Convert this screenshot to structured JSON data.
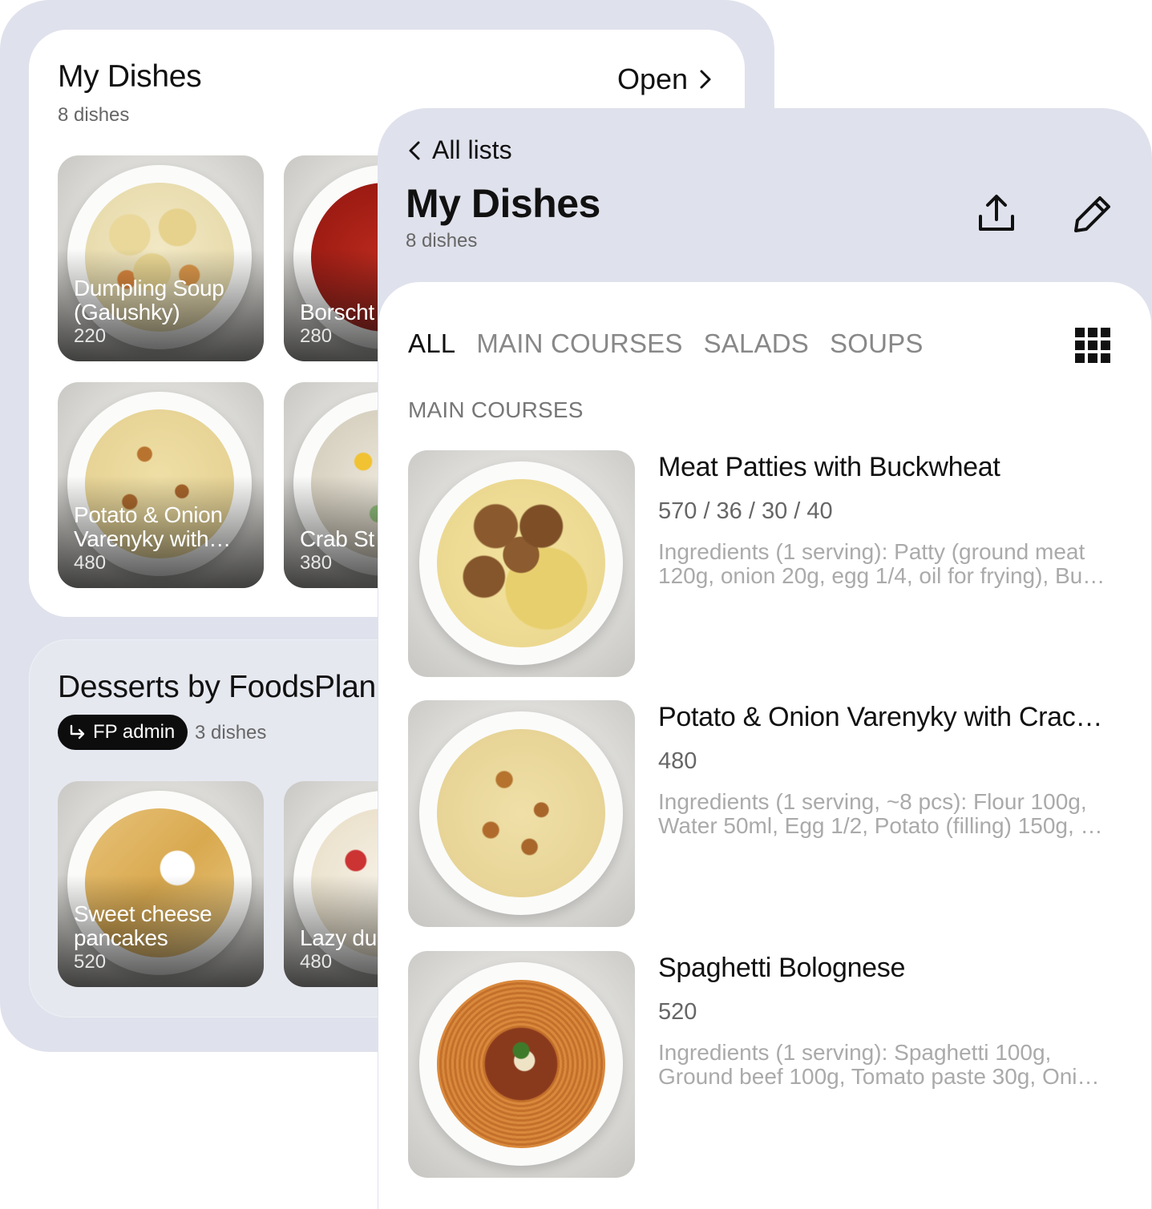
{
  "back_panel": {
    "my_dishes": {
      "title": "My Dishes",
      "count": "8 dishes",
      "open_label": "Open",
      "tiles": [
        {
          "name": "Dumpling Soup (Galushky)",
          "cal": "220"
        },
        {
          "name": "Borscht",
          "cal": "280"
        },
        {
          "name": "Potato & Onion Varenyky with…",
          "cal": "480"
        },
        {
          "name": "Crab St",
          "cal": "380"
        }
      ]
    },
    "desserts": {
      "title": "Desserts by FoodsPlan",
      "badge": "FP admin",
      "count": "3 dishes",
      "tiles": [
        {
          "name": "Sweet cheese pancakes",
          "cal": "520"
        },
        {
          "name": "Lazy du (sweet)",
          "cal": "480"
        }
      ]
    }
  },
  "front_panel": {
    "back_label": "All lists",
    "title": "My Dishes",
    "count": "8 dishes",
    "tabs": [
      "ALL",
      "MAIN COURSES",
      "SALADS",
      "SOUPS"
    ],
    "active_tab": "ALL",
    "section": "MAIN COURSES",
    "dishes": [
      {
        "name": "Meat Patties with Buckwheat",
        "macros": "570 / 36 / 30 / 40",
        "ingredients": "Ingredients (1 serving): Patty (ground meat 120g, onion 20g, egg 1/4, oil for frying), Bu…"
      },
      {
        "name": "Potato & Onion Varenyky with Crac…",
        "macros": "480",
        "ingredients": "Ingredients (1 serving, ~8 pcs): Flour 100g, Water 50ml, Egg 1/2, Potato (filling) 150g, …"
      },
      {
        "name": "Spaghetti Bolognese",
        "macros": "520",
        "ingredients": "Ingredients (1 serving): Spaghetti 100g, Ground beef 100g, Tomato paste 30g, Oni…"
      }
    ]
  },
  "icons": [
    "chevron-right-icon",
    "chevron-left-icon",
    "share-icon",
    "edit-pencil-icon",
    "grid-view-icon",
    "reply-arrow-icon"
  ],
  "colors": {
    "panel_bg": "#dfe1ec",
    "text": "#111111",
    "muted": "#888888"
  }
}
